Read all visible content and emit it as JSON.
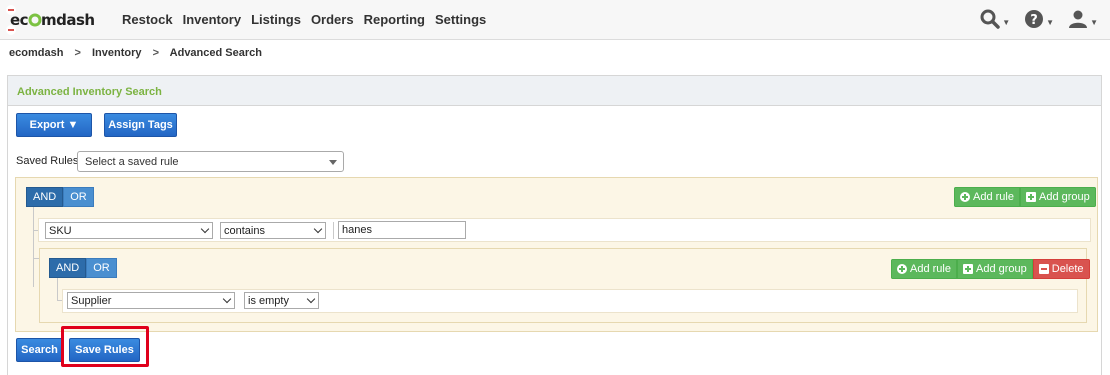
{
  "app": {
    "logo_text": "ecomdash",
    "nav": [
      "Restock",
      "Inventory",
      "Listings",
      "Orders",
      "Reporting",
      "Settings"
    ],
    "icons": [
      "search-icon",
      "help-icon",
      "user-icon"
    ]
  },
  "breadcrumb": [
    "ecomdash",
    ">",
    "Inventory",
    ">",
    "Advanced Search"
  ],
  "panel": {
    "title": "Advanced Inventory Search"
  },
  "toolbar": {
    "export_label": "Export ▼",
    "assign_tags_label": "Assign Tags"
  },
  "saved_rules": {
    "label": "Saved Rules:",
    "selected": "Select a saved rule"
  },
  "builder": {
    "and_label": "AND",
    "or_label": "OR",
    "add_rule_label": "Add rule",
    "add_group_label": "Add group",
    "delete_label": "Delete",
    "rule1": {
      "field": "SKU",
      "operator": "contains",
      "value": "hanes"
    },
    "rule2": {
      "field": "Supplier",
      "operator": "is empty"
    }
  },
  "actions": {
    "search_label": "Search",
    "save_rules_label": "Save Rules"
  },
  "colors": {
    "accent_blue": "#2366c4",
    "green": "#5cb85c",
    "red": "#d9534f",
    "title_green": "#7cb342",
    "highlight": "#e0001b"
  }
}
